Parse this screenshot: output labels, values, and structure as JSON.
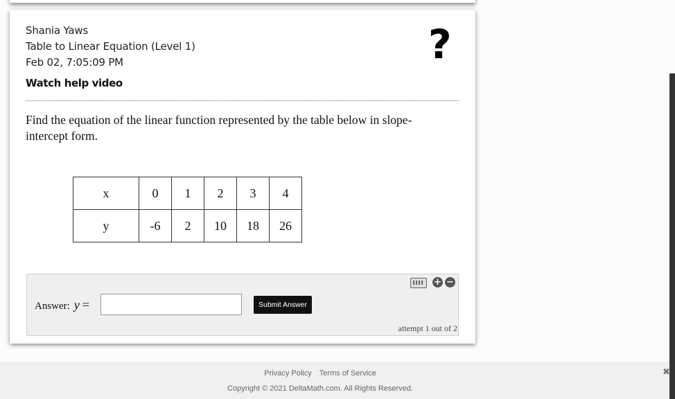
{
  "header": {
    "student_name": "Shania Yaws",
    "assignment_title": "Table to Linear Equation (Level 1)",
    "timestamp": "Feb 02, 7:05:09 PM",
    "help_video_label": "Watch help video",
    "help_icon": "?"
  },
  "question": {
    "prompt": "Find the equation of the linear function represented by the table below in slope-intercept form.",
    "table": {
      "x_label": "x",
      "y_label": "y",
      "x_values": [
        "0",
        "1",
        "2",
        "3",
        "4"
      ],
      "y_values": [
        "-6",
        "2",
        "10",
        "18",
        "26"
      ]
    }
  },
  "answer": {
    "label": "Answer:",
    "variable": "y",
    "equals": "=",
    "input_value": "",
    "submit_label": "Submit Answer",
    "attempt_text": "attempt 1 out of 2",
    "icons": [
      "keyboard-icon",
      "plus-icon",
      "minus-icon"
    ]
  },
  "footer": {
    "privacy_label": "Privacy Policy",
    "terms_label": "Terms of Service",
    "copyright": "Copyright © 2021 DeltaMath.com. All Rights Reserved.",
    "close_glyph": "✖"
  }
}
